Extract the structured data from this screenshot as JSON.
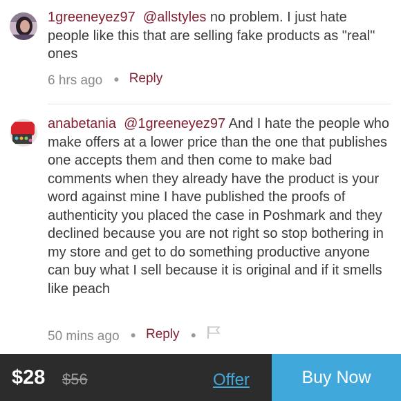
{
  "comments": [
    {
      "username": "1greeneyez97",
      "mention": "@allstyles",
      "body": "no problem. I just hate people like this that are selling fake products as \"real\" ones",
      "time": "6 hrs ago",
      "reply_label": "Reply",
      "avatar_icon": "user-avatar-1greeneyez97"
    },
    {
      "username": "anabetania",
      "mention": "@1greeneyez97",
      "body": "And I hate the people who make offers at a lower price than the one that publishes one accepts them and then come to make bad comments when they already have the product is your word against mine I have published the proofs of authenticity you placed the case in Poshmark and they declined because you are not right so stop bothering in my store and get to do something productive anyone can buy what I sell because it is original and if it smells like peach",
      "time": "50 mins ago",
      "reply_label": "Reply",
      "avatar_icon": "user-avatar-anabetania",
      "report_icon": "flag-icon"
    }
  ],
  "purchase_bar": {
    "price": "$28",
    "original_price": "$56",
    "offer_label": "Offer",
    "buy_label": "Buy Now"
  },
  "colors": {
    "username": "#822032",
    "accent_blue": "#41a8dc",
    "bar_background": "#2c2c2c"
  }
}
